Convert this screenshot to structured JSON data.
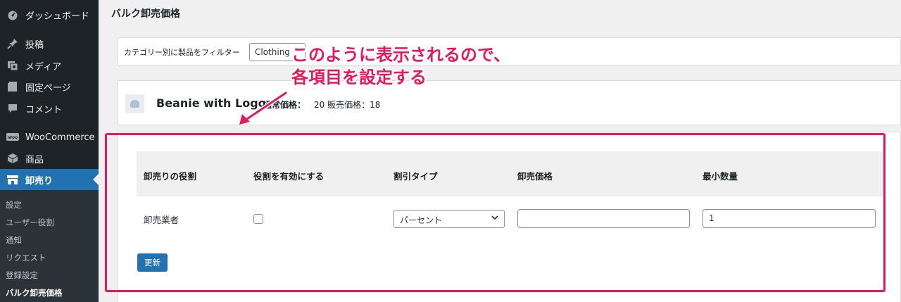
{
  "sidebar": {
    "items": [
      {
        "label": "ダッシュボード",
        "icon": "dashboard-icon"
      },
      {
        "label": "投稿",
        "icon": "pin-icon"
      },
      {
        "label": "メディア",
        "icon": "media-icon"
      },
      {
        "label": "固定ページ",
        "icon": "page-icon"
      },
      {
        "label": "コメント",
        "icon": "comment-icon"
      },
      {
        "label": "WooCommerce",
        "icon": "woo-icon"
      },
      {
        "label": "商品",
        "icon": "box-icon"
      },
      {
        "label": "卸売り",
        "icon": "store-icon"
      }
    ],
    "submenu": [
      "設定",
      "ユーザー役割",
      "通知",
      "リクエスト",
      "登録設定",
      "バルク卸売価格"
    ]
  },
  "page": {
    "title": "バルク卸売価格"
  },
  "filter": {
    "label": "カテゴリー別に製品をフィルター",
    "selected": "Clothing"
  },
  "product": {
    "name": "Beanie with Logo",
    "price_label": "通常価格：",
    "price_value": "20 販売価格：18"
  },
  "table": {
    "headers": [
      "卸売りの役割",
      "役割を有効にする",
      "割引タイプ",
      "卸売価格",
      "最小数量"
    ],
    "row": {
      "role": "卸売業者",
      "enabled": false,
      "discount_type": "パーセント",
      "wholesale_price": "",
      "min_qty": "1"
    }
  },
  "buttons": {
    "update": "更新"
  },
  "annotation": {
    "line1": "このように表示されるので、",
    "line2": "各項目を設定する",
    "color": "#e8185c"
  },
  "colors": {
    "sidebar_bg": "#1d2327",
    "accent": "#2271b1"
  }
}
